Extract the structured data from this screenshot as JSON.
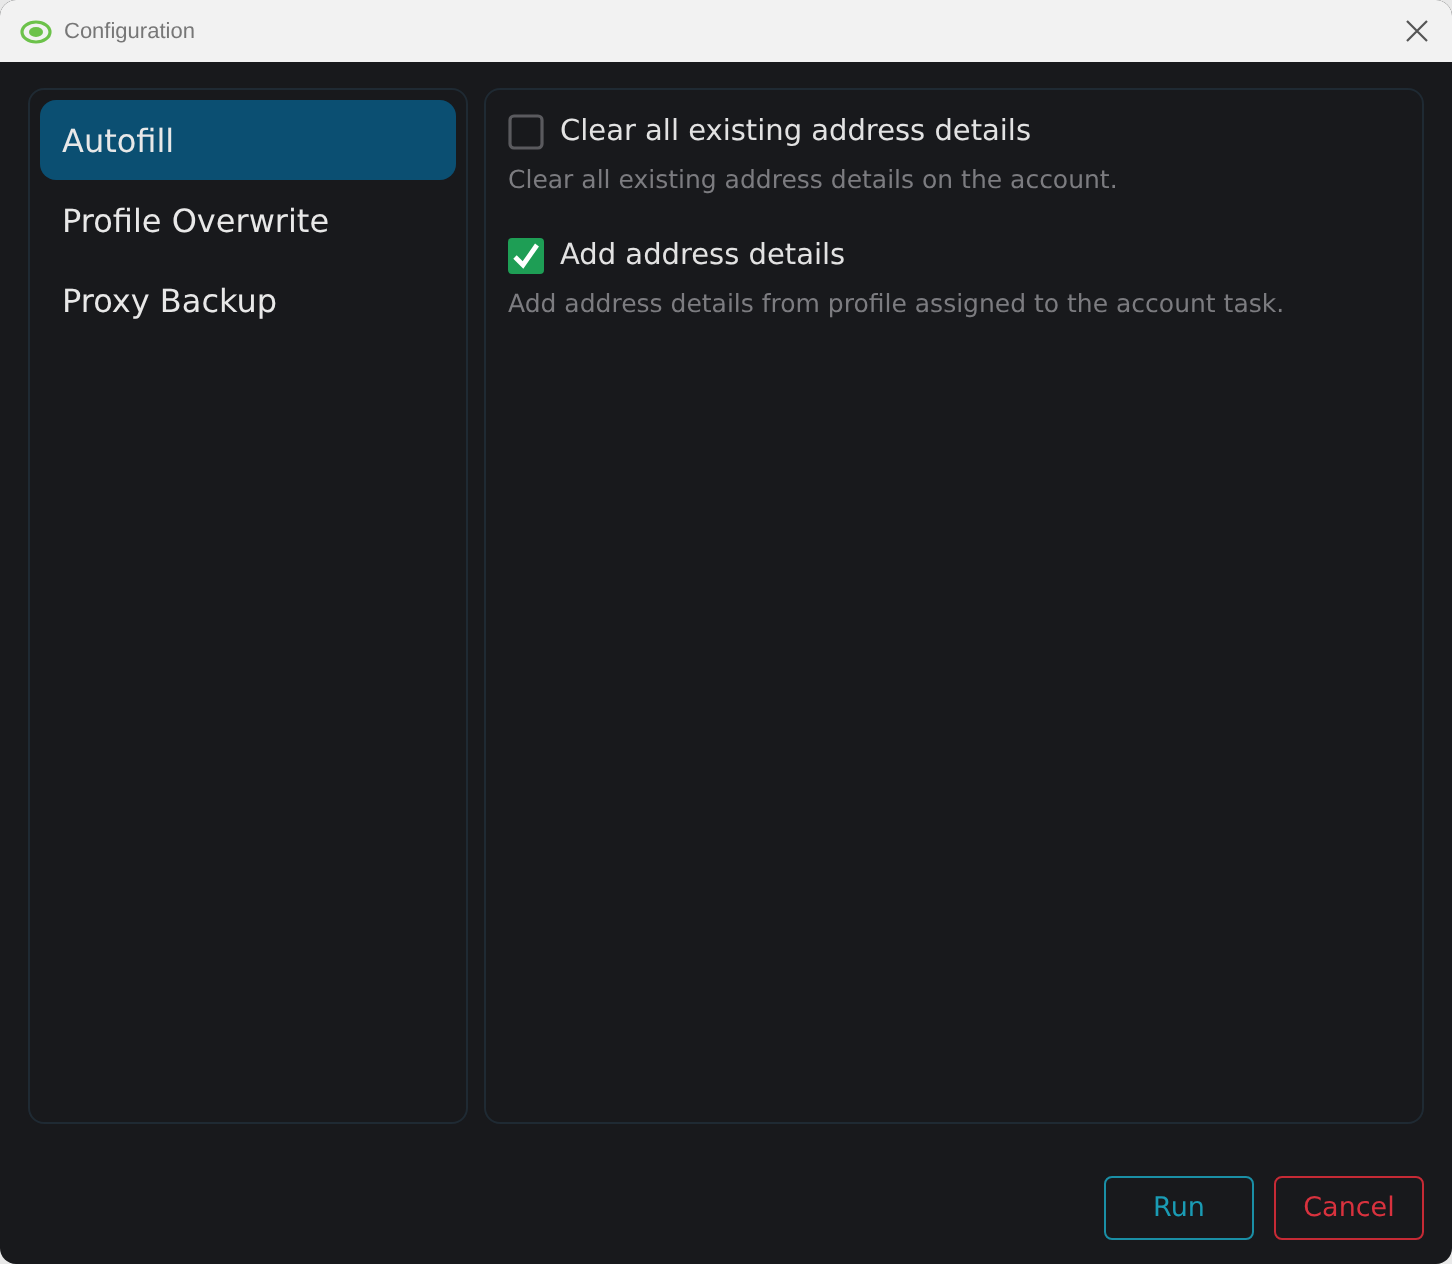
{
  "window": {
    "title": "Configuration"
  },
  "sidebar": {
    "items": [
      {
        "label": "Autofill",
        "selected": true
      },
      {
        "label": "Profile Overwrite",
        "selected": false
      },
      {
        "label": "Proxy Backup",
        "selected": false
      }
    ]
  },
  "options": [
    {
      "label": "Clear all existing address details",
      "description": "Clear all existing address details on the account.",
      "checked": false
    },
    {
      "label": "Add address details",
      "description": "Add address details from profile assigned to the account task.",
      "checked": true
    }
  ],
  "buttons": [
    {
      "label": "Run",
      "kind": "primary"
    },
    {
      "label": "Cancel",
      "kind": "danger"
    }
  ]
}
